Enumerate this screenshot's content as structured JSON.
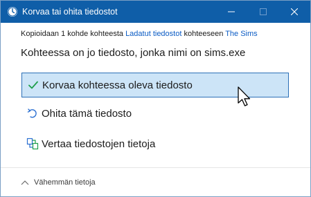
{
  "window": {
    "title": "Korvaa tai ohita tiedostot"
  },
  "copy_info": {
    "prefix": "Kopioidaan 1 kohde kohteesta ",
    "source_link": "Ladatut tiedostot",
    "middle": " kohteeseen ",
    "destination_link": "The Sims"
  },
  "headline": "Kohteessa on jo tiedosto, jonka nimi on sims.exe",
  "options": [
    {
      "label": "Korvaa kohteessa oleva tiedosto",
      "icon": "checkmark-icon",
      "selected": true
    },
    {
      "label": "Ohita tämä tiedosto",
      "icon": "skip-arrow-icon",
      "selected": false
    },
    {
      "label": "Vertaa tiedostojen tietoja",
      "icon": "compare-icon",
      "selected": false
    }
  ],
  "footer": {
    "toggle_label": "Vähemmän tietoja"
  },
  "colors": {
    "titlebar": "#0f5ea8",
    "link": "#0a5bc4",
    "selected_bg": "#cce4f7",
    "selected_border": "#2b6fb6",
    "check": "#1e9e4a"
  }
}
